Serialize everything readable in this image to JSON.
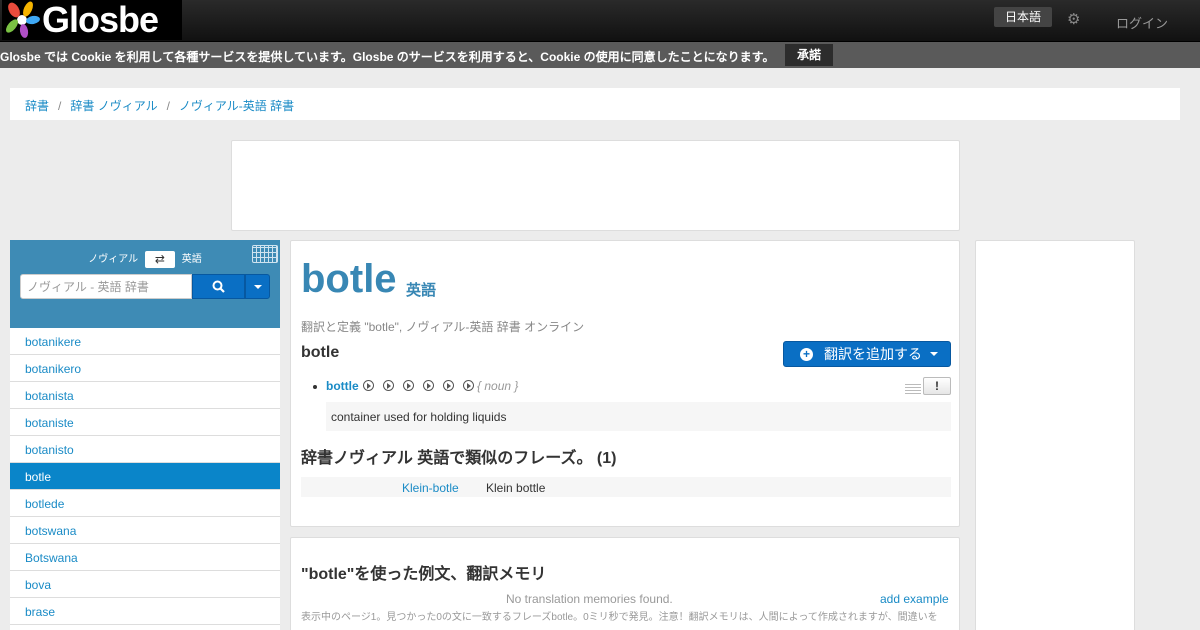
{
  "header": {
    "logo_text": "Glosbe",
    "language_button": "日本語",
    "settings_icon": "gear-icon",
    "login_label": "ログイン"
  },
  "cookie_bar": {
    "message": "Glosbe では Cookie を利用して各種サービスを提供しています。Glosbe のサービスを利用すると、Cookie の使用に同意したことになります。",
    "accept_label": "承諾"
  },
  "breadcrumb": {
    "items": [
      "辞書",
      "辞書 ノヴィアル",
      "ノヴィアル-英語 辞書"
    ],
    "separator": "/"
  },
  "search": {
    "source_lang": "ノヴィアル",
    "target_lang": "英語",
    "swap_icon": "swap-arrows-icon",
    "keyboard_icon": "keyboard-icon",
    "placeholder": "ノヴィアル - 英語 辞書",
    "search_icon": "search-icon"
  },
  "wordlist": {
    "items": [
      "botanikere",
      "botanikero",
      "botanista",
      "botaniste",
      "botanisto",
      "botle",
      "botlede",
      "botswana",
      "Botswana",
      "bova",
      "brase"
    ],
    "active_index": 5
  },
  "entry": {
    "word": "botle",
    "language": "英語",
    "subtitle": "翻訳と定義 \"botle\", ノヴィアル-英語 辞書  オンライン",
    "lemma": "botle",
    "add_translation_label": "翻訳を追加する",
    "translation": {
      "word": "bottle",
      "pos": "{ noun }",
      "definition": "container used for holding liquids",
      "report_label": "!"
    },
    "similar_phrases_title": "辞書ノヴィアル 英語で類似のフレーズ。 (1)",
    "phrases": [
      {
        "source": "Klein-botle",
        "target": "Klein bottle"
      }
    ]
  },
  "examples": {
    "title": "\"botle\"を使った例文、翻訳メモリ",
    "no_tm": "No translation memories found.",
    "add_example_label": "add example",
    "note": "表示中のページ1。見つかった0の文に一致するフレーズbotle。0ミリ秒で発見。注意！翻訳メモリは、人間によって作成されますが、間違いを"
  }
}
